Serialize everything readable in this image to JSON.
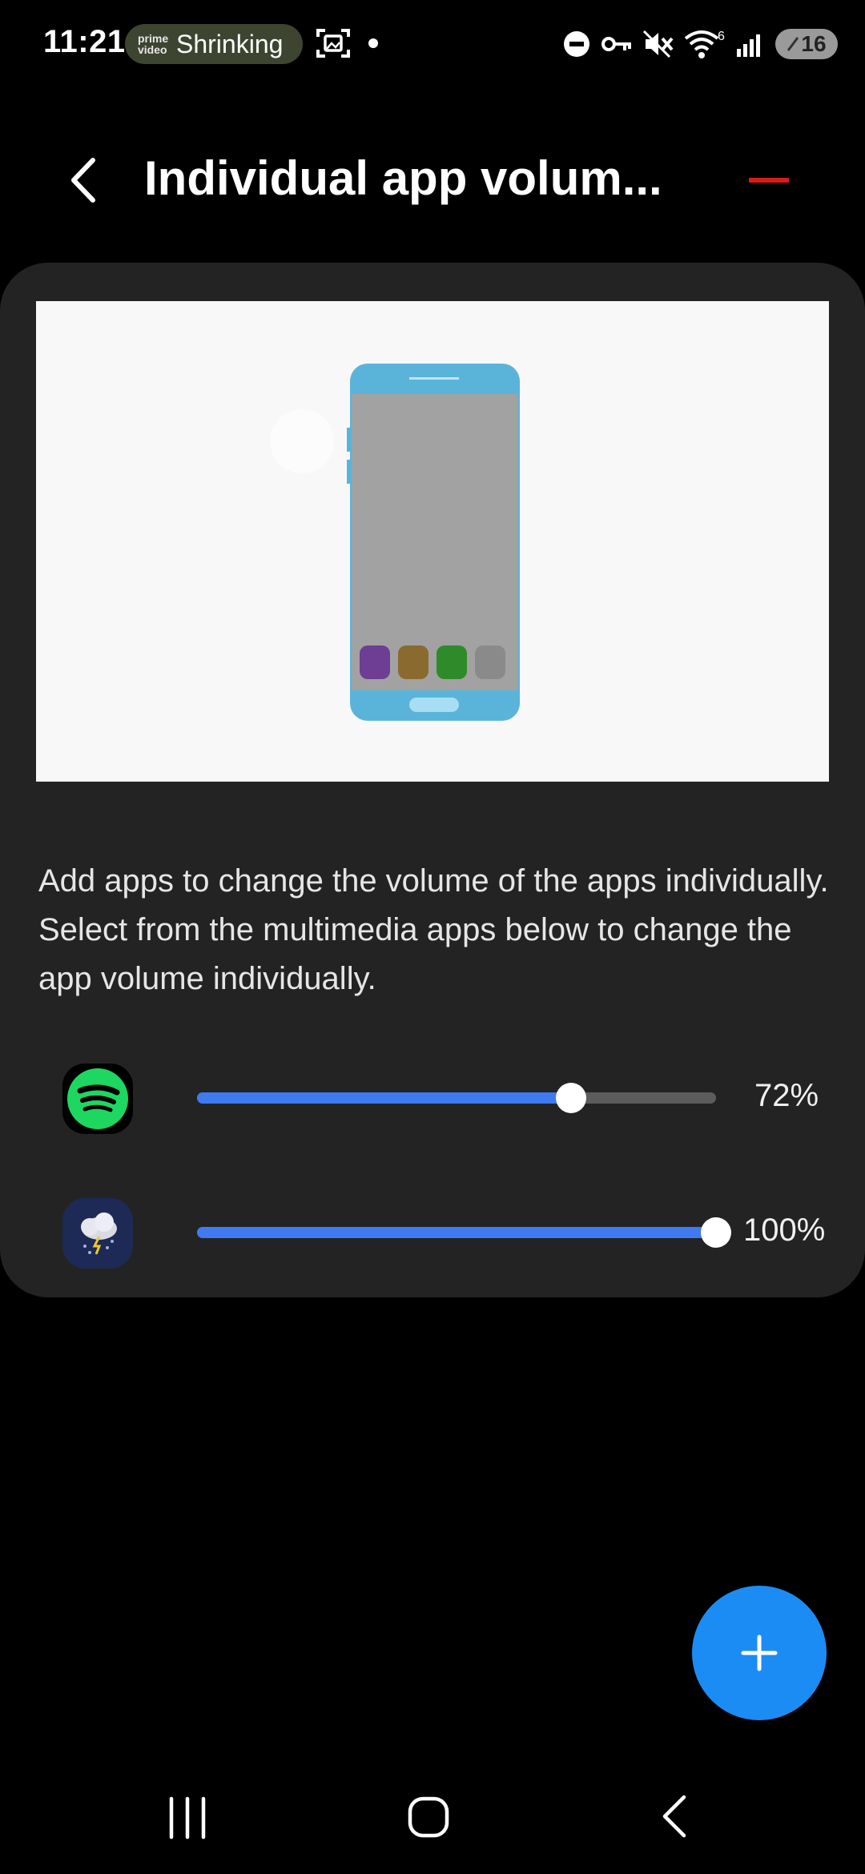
{
  "status_bar": {
    "time": "11:21",
    "media_app": "prime video",
    "media_title": "Shrinking",
    "battery": "16",
    "wifi_label": "6"
  },
  "header": {
    "title": "Individual app volum..."
  },
  "description": "Add apps to change the volume of the apps individually. Select from the multimedia apps below to change the app volume individually.",
  "apps": [
    {
      "name": "Spotify",
      "icon": "spotify-icon",
      "volume": 0.72,
      "volume_label": "72%",
      "accent": "#1ed760"
    },
    {
      "name": "Weather",
      "icon": "weather-icon",
      "volume": 1.0,
      "volume_label": "100%",
      "accent": "#1d2a55"
    }
  ],
  "colors": {
    "slider_fill": "#3f7af0",
    "fab": "#1c8cf5",
    "card": "#232323",
    "header_accent": "#d81b1b"
  }
}
